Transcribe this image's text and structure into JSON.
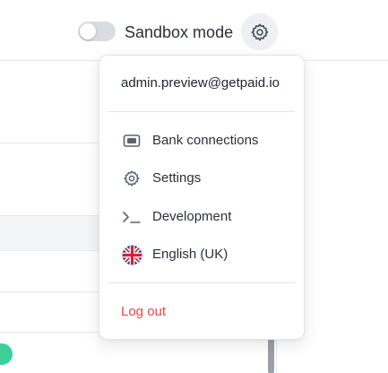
{
  "topbar": {
    "sandbox_label": "Sandbox mode",
    "sandbox_enabled": false
  },
  "menu": {
    "email": "admin.preview@getpaid.io",
    "items": [
      {
        "label": "Bank connections",
        "icon": "bank-card-icon"
      },
      {
        "label": "Settings",
        "icon": "gear-icon"
      },
      {
        "label": "Development",
        "icon": "terminal-icon"
      },
      {
        "label": "English (UK)",
        "icon": "uk-flag-icon"
      }
    ],
    "logout_label": "Log out"
  },
  "colors": {
    "logout": "#e5484d",
    "icon": "#5b6270",
    "accent_green": "#3ecf9b"
  }
}
